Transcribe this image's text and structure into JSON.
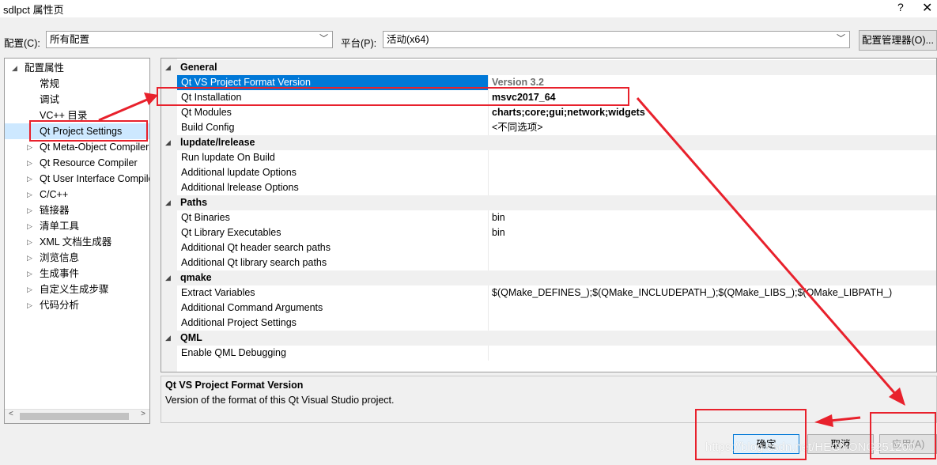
{
  "window": {
    "title": "sdlpct 属性页",
    "help_glyph": "?",
    "close_glyph": "✕"
  },
  "config_bar": {
    "config_label": "配置(C):",
    "config_value": "所有配置",
    "platform_label": "平台(P):",
    "platform_value": "活动(x64)",
    "manager_button": "配置管理器(O)..."
  },
  "tree": {
    "items": [
      {
        "label": "配置属性",
        "arrow": "◢"
      },
      {
        "label": "常规",
        "arrow": ""
      },
      {
        "label": "调试",
        "arrow": ""
      },
      {
        "label": "VC++ 目录",
        "arrow": ""
      },
      {
        "label": "Qt Project Settings",
        "arrow": ""
      },
      {
        "label": "Qt Meta-Object Compiler",
        "arrow": "▷"
      },
      {
        "label": "Qt Resource Compiler",
        "arrow": "▷"
      },
      {
        "label": "Qt User Interface Compiler",
        "arrow": "▷"
      },
      {
        "label": "C/C++",
        "arrow": "▷"
      },
      {
        "label": "链接器",
        "arrow": "▷"
      },
      {
        "label": "清单工具",
        "arrow": "▷"
      },
      {
        "label": "XML 文档生成器",
        "arrow": "▷"
      },
      {
        "label": "浏览信息",
        "arrow": "▷"
      },
      {
        "label": "生成事件",
        "arrow": "▷"
      },
      {
        "label": "自定义生成步骤",
        "arrow": "▷"
      },
      {
        "label": "代码分析",
        "arrow": "▷"
      }
    ],
    "scroll_left": "<",
    "scroll_right": ">"
  },
  "grid": {
    "rows": [
      {
        "kind": "cat",
        "name": "General",
        "toggle": "◢"
      },
      {
        "kind": "prop",
        "name": "Qt VS Project Format Version",
        "value": "Version 3.2",
        "selected": true,
        "style": "bold gray"
      },
      {
        "kind": "prop",
        "name": "Qt Installation",
        "value": "msvc2017_64",
        "style": "bold"
      },
      {
        "kind": "prop",
        "name": "Qt Modules",
        "value": "charts;core;gui;network;widgets",
        "style": "bold"
      },
      {
        "kind": "prop",
        "name": "Build Config",
        "value": "<不同选项>",
        "style": ""
      },
      {
        "kind": "cat",
        "name": "lupdate/lrelease",
        "toggle": "◢"
      },
      {
        "kind": "prop",
        "name": "Run lupdate On Build",
        "value": "",
        "style": ""
      },
      {
        "kind": "prop",
        "name": "Additional lupdate Options",
        "value": "",
        "style": ""
      },
      {
        "kind": "prop",
        "name": "Additional lrelease Options",
        "value": "",
        "style": ""
      },
      {
        "kind": "cat",
        "name": "Paths",
        "toggle": "◢"
      },
      {
        "kind": "prop",
        "name": "Qt Binaries",
        "value": "bin",
        "style": ""
      },
      {
        "kind": "prop",
        "name": "Qt Library Executables",
        "value": "bin",
        "style": ""
      },
      {
        "kind": "prop",
        "name": "Additional Qt header search paths",
        "value": "",
        "style": ""
      },
      {
        "kind": "prop",
        "name": "Additional Qt library search paths",
        "value": "",
        "style": ""
      },
      {
        "kind": "cat",
        "name": "qmake",
        "toggle": "◢"
      },
      {
        "kind": "prop",
        "name": "Extract Variables",
        "value": "$(QMake_DEFINES_);$(QMake_INCLUDEPATH_);$(QMake_LIBS_);$(QMake_LIBPATH_)",
        "style": ""
      },
      {
        "kind": "prop",
        "name": "Additional Command Arguments",
        "value": "",
        "style": ""
      },
      {
        "kind": "prop",
        "name": "Additional Project Settings",
        "value": "",
        "style": ""
      },
      {
        "kind": "cat",
        "name": "QML",
        "toggle": "◢"
      },
      {
        "kind": "prop",
        "name": "Enable QML Debugging",
        "value": "",
        "style": ""
      }
    ]
  },
  "description": {
    "title": "Qt VS Project Format Version",
    "text": "Version of the format of this Qt Visual Studio project."
  },
  "footer": {
    "ok": "确定",
    "cancel": "取消",
    "apply": "应用(A)"
  },
  "watermark": "https://blog.csdn.net/HEGYONG251200",
  "colors": {
    "annotation_red": "#e8212c",
    "selection_blue": "#0078d7"
  }
}
